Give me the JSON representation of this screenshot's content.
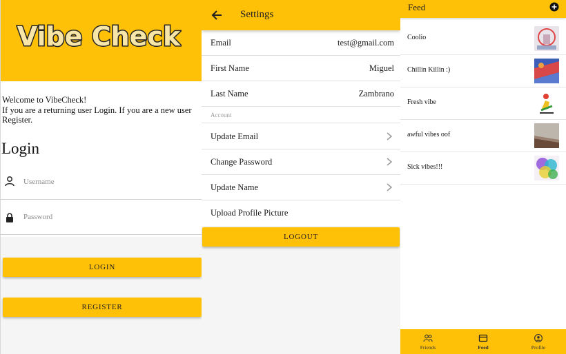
{
  "login": {
    "logo_text": "Vibe Check",
    "welcome_line1": "Welcome to VibeCheck!",
    "welcome_line2": "If you are a returning user Login. If you are a new user Register.",
    "title": "Login",
    "username_placeholder": "Username",
    "password_placeholder": "Password",
    "login_button": "LOGIN",
    "register_button": "REGISTER"
  },
  "settings": {
    "title": "Settings",
    "email_label": "Email",
    "email_value": "test@gmail.com",
    "first_name_label": "First Name",
    "first_name_value": "Miguel",
    "last_name_label": "Last Name",
    "last_name_value": "Zambrano",
    "account_section": "Account",
    "update_email": "Update Email",
    "change_password": "Change Password",
    "update_name": "Update Name",
    "upload_picture": "Upload Profile Picture",
    "logout_button": "LOGOUT"
  },
  "feed": {
    "title": "Feed",
    "items": [
      {
        "title": "Coolio"
      },
      {
        "title": "Chillin Killin :)"
      },
      {
        "title": "Fresh vibe"
      },
      {
        "title": "awful vibes oof"
      },
      {
        "title": "Sick vibes!!!"
      }
    ],
    "nav": {
      "friends": "Friends",
      "feed": "Feed",
      "profile": "Profile"
    }
  },
  "colors": {
    "accent": "#ffc107",
    "background": "#f5f5f5"
  },
  "icons": [
    "person-icon",
    "lock-icon",
    "back-arrow-icon",
    "chevron-right-icon",
    "add-circle-icon",
    "friends-icon",
    "feed-icon",
    "profile-icon"
  ]
}
